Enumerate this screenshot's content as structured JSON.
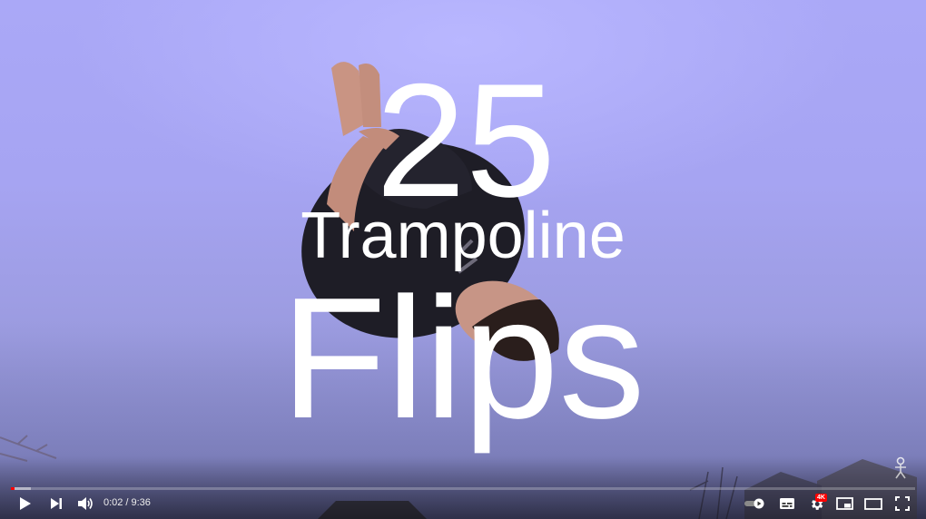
{
  "video": {
    "title_line1": "25",
    "title_line2": "Trampoline",
    "title_line3": "Flips",
    "played_fraction": 0.0036,
    "buffered_fraction": 0.022
  },
  "controls": {
    "current_time": "0:02",
    "separator": "/",
    "duration": "9:36",
    "quality_badge": "4K",
    "icons": [
      "play-icon",
      "next-icon",
      "volume-icon",
      "autoplay-toggle-icon",
      "subtitles-icon",
      "settings-icon",
      "miniplayer-icon",
      "theater-mode-icon",
      "fullscreen-icon"
    ]
  },
  "colors": {
    "progress_played": "#ff0000",
    "sky_top": "#aaa8f7",
    "text": "#ffffff"
  }
}
